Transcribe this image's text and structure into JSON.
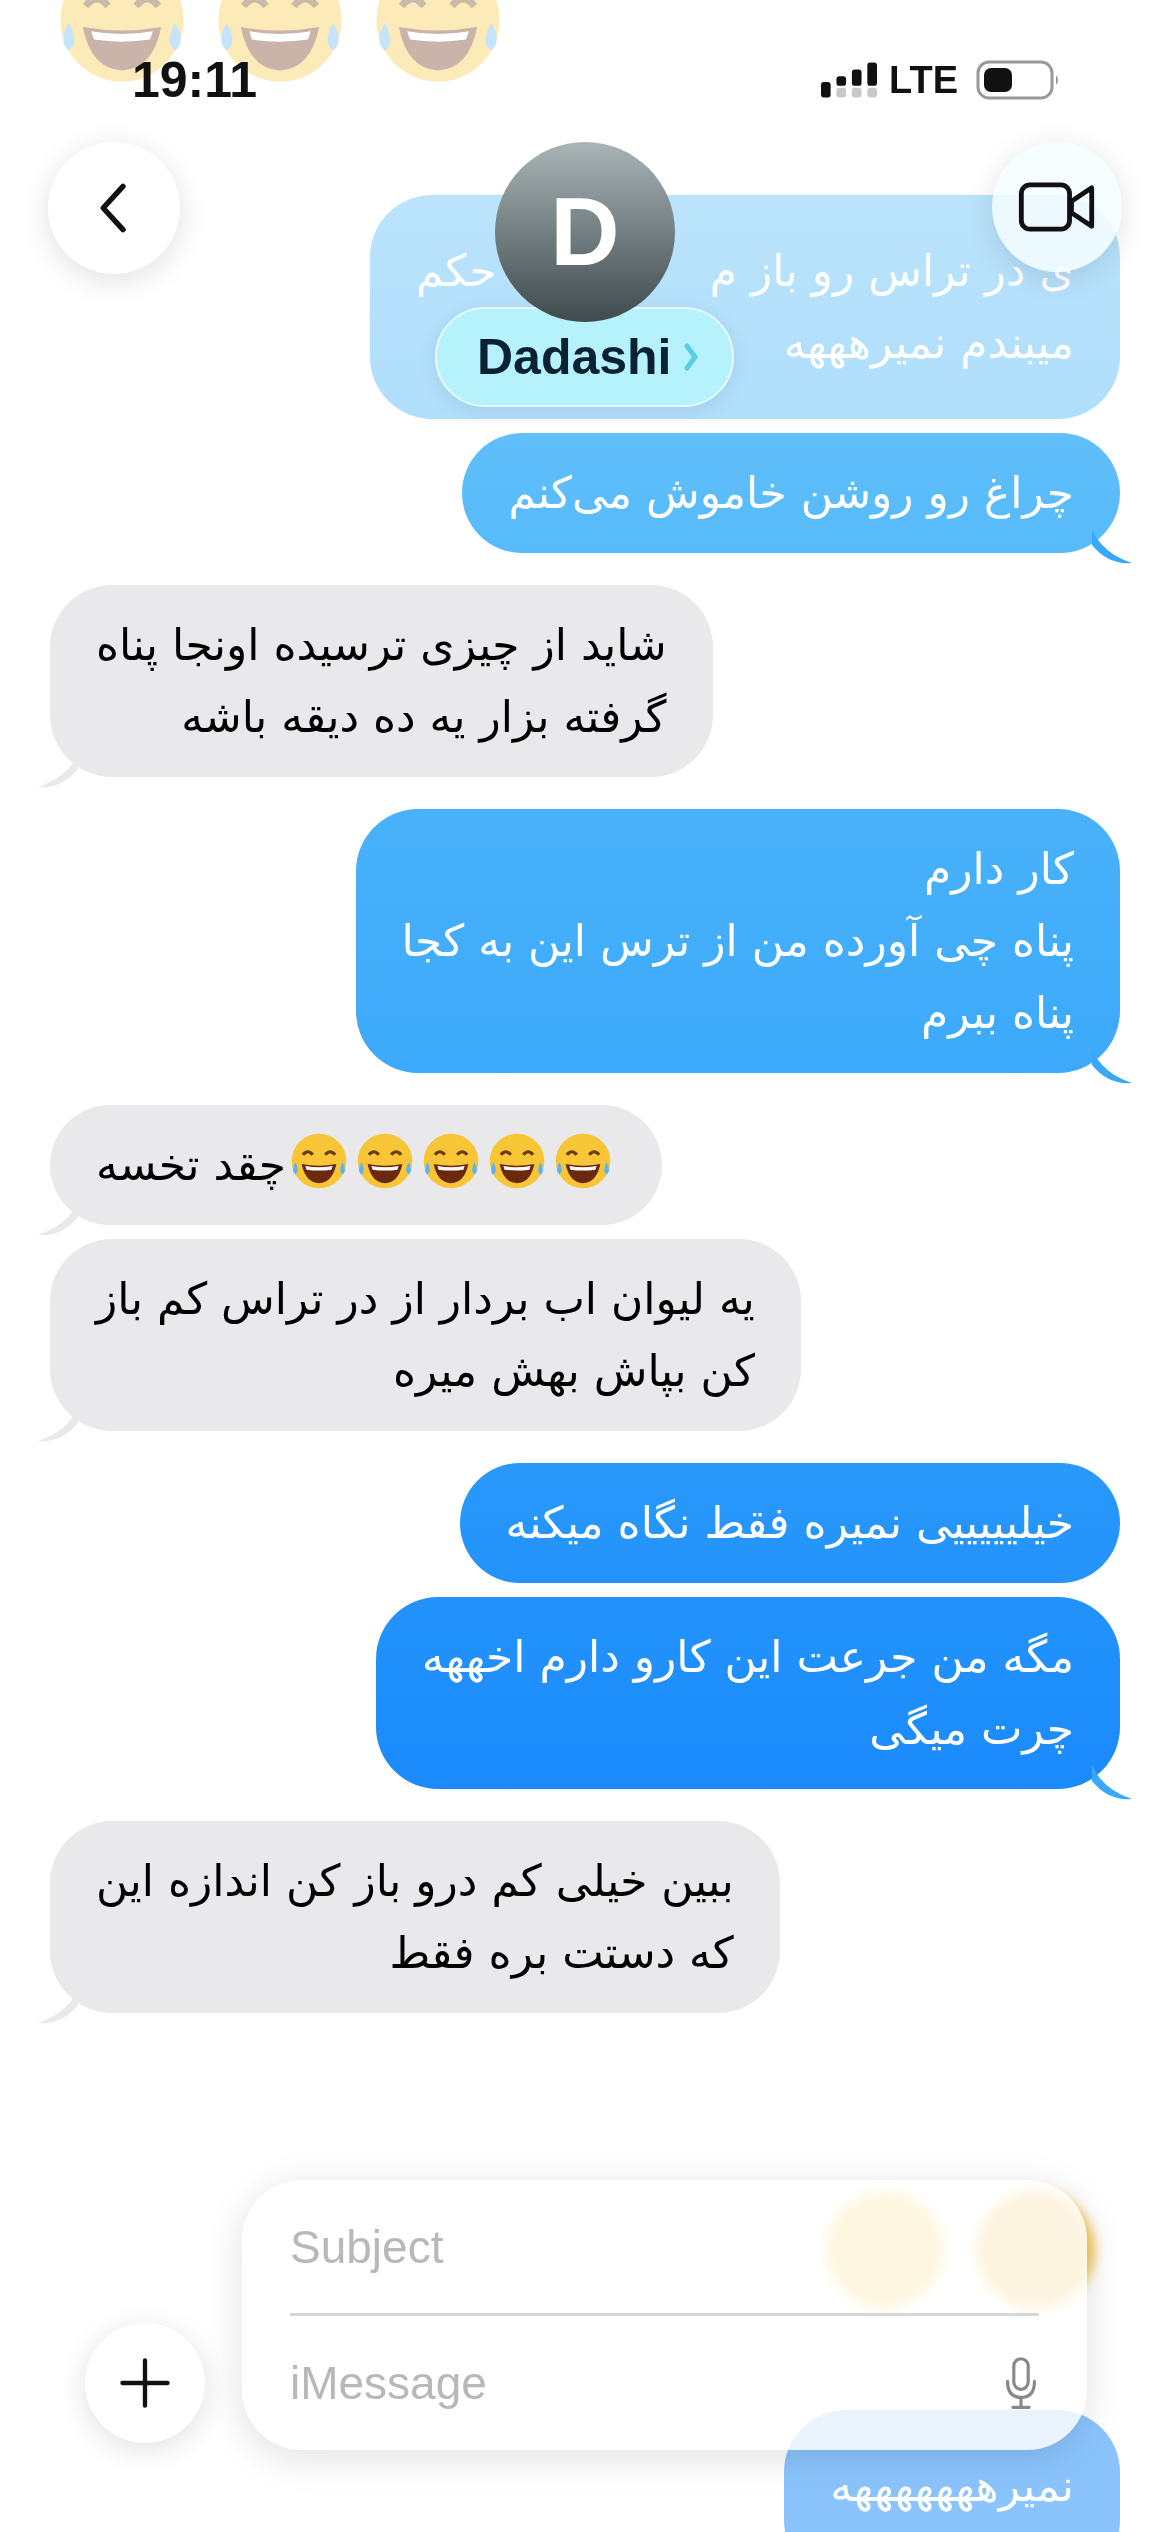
{
  "status_bar": {
    "time": "19:11",
    "network": "LTE"
  },
  "header": {
    "contact_initial": "D",
    "contact_name": "Dadashi"
  },
  "messages": [
    {
      "kind": "sent",
      "faded": true,
      "tail": false,
      "parts": [
        {
          "kind": "text",
          "text": "ی در تراس رو باز م"
        },
        {
          "kind": "gap"
        },
        {
          "kind": "text",
          "text": "حکم"
        },
        {
          "kind": "break"
        },
        {
          "kind": "text",
          "text": "میبندم نمیرهههه"
        }
      ]
    },
    {
      "kind": "sent",
      "faded": false,
      "tail": true,
      "parts": [
        {
          "kind": "text",
          "text": "چراغ رو روشن خاموش می‌کنم"
        }
      ]
    },
    {
      "kind": "received",
      "faded": false,
      "tail": true,
      "parts": [
        {
          "kind": "text",
          "text": "شاید از چیزی ترسیده اونجا پناه\nگرفته بزار یه ده دیقه باشه"
        }
      ]
    },
    {
      "kind": "sent",
      "faded": false,
      "tail": true,
      "parts": [
        {
          "kind": "text",
          "text": "کار دارم\nپناه چی آورده من از ترس این به کجا\nپناه ببرم"
        }
      ]
    },
    {
      "kind": "received",
      "faded": false,
      "tail": true,
      "parts": [
        {
          "kind": "emoji"
        },
        {
          "kind": "emoji"
        },
        {
          "kind": "emoji"
        },
        {
          "kind": "emoji"
        },
        {
          "kind": "emoji"
        },
        {
          "kind": "text",
          "text": "چقد تخسه"
        }
      ]
    },
    {
      "kind": "received",
      "faded": false,
      "tail": true,
      "parts": [
        {
          "kind": "text",
          "text": "یه لیوان اب بردار از در تراس کم باز\nکن بپاش بهش میره"
        }
      ]
    },
    {
      "kind": "sent",
      "faded": false,
      "tail": false,
      "parts": [
        {
          "kind": "text",
          "text": "خیلیییییی نمیره فقط نگاه میکنه"
        }
      ]
    },
    {
      "kind": "sent",
      "faded": false,
      "tail": true,
      "parts": [
        {
          "kind": "text",
          "text": "مگه من جرعت این کارو دارم اخههه\nچرت میگی"
        }
      ]
    },
    {
      "kind": "received",
      "faded": false,
      "tail": true,
      "parts": [
        {
          "kind": "text",
          "text": "ببین خیلی کم درو باز کن اندازه این\nکه دستت بره فقط"
        }
      ]
    },
    {
      "kind": "sent",
      "faded": true,
      "tail": false,
      "parts": [
        {
          "kind": "text",
          "text": "نمیرهههههههه"
        }
      ]
    }
  ],
  "compose": {
    "subject_placeholder": "Subject",
    "message_placeholder": "iMessage"
  }
}
